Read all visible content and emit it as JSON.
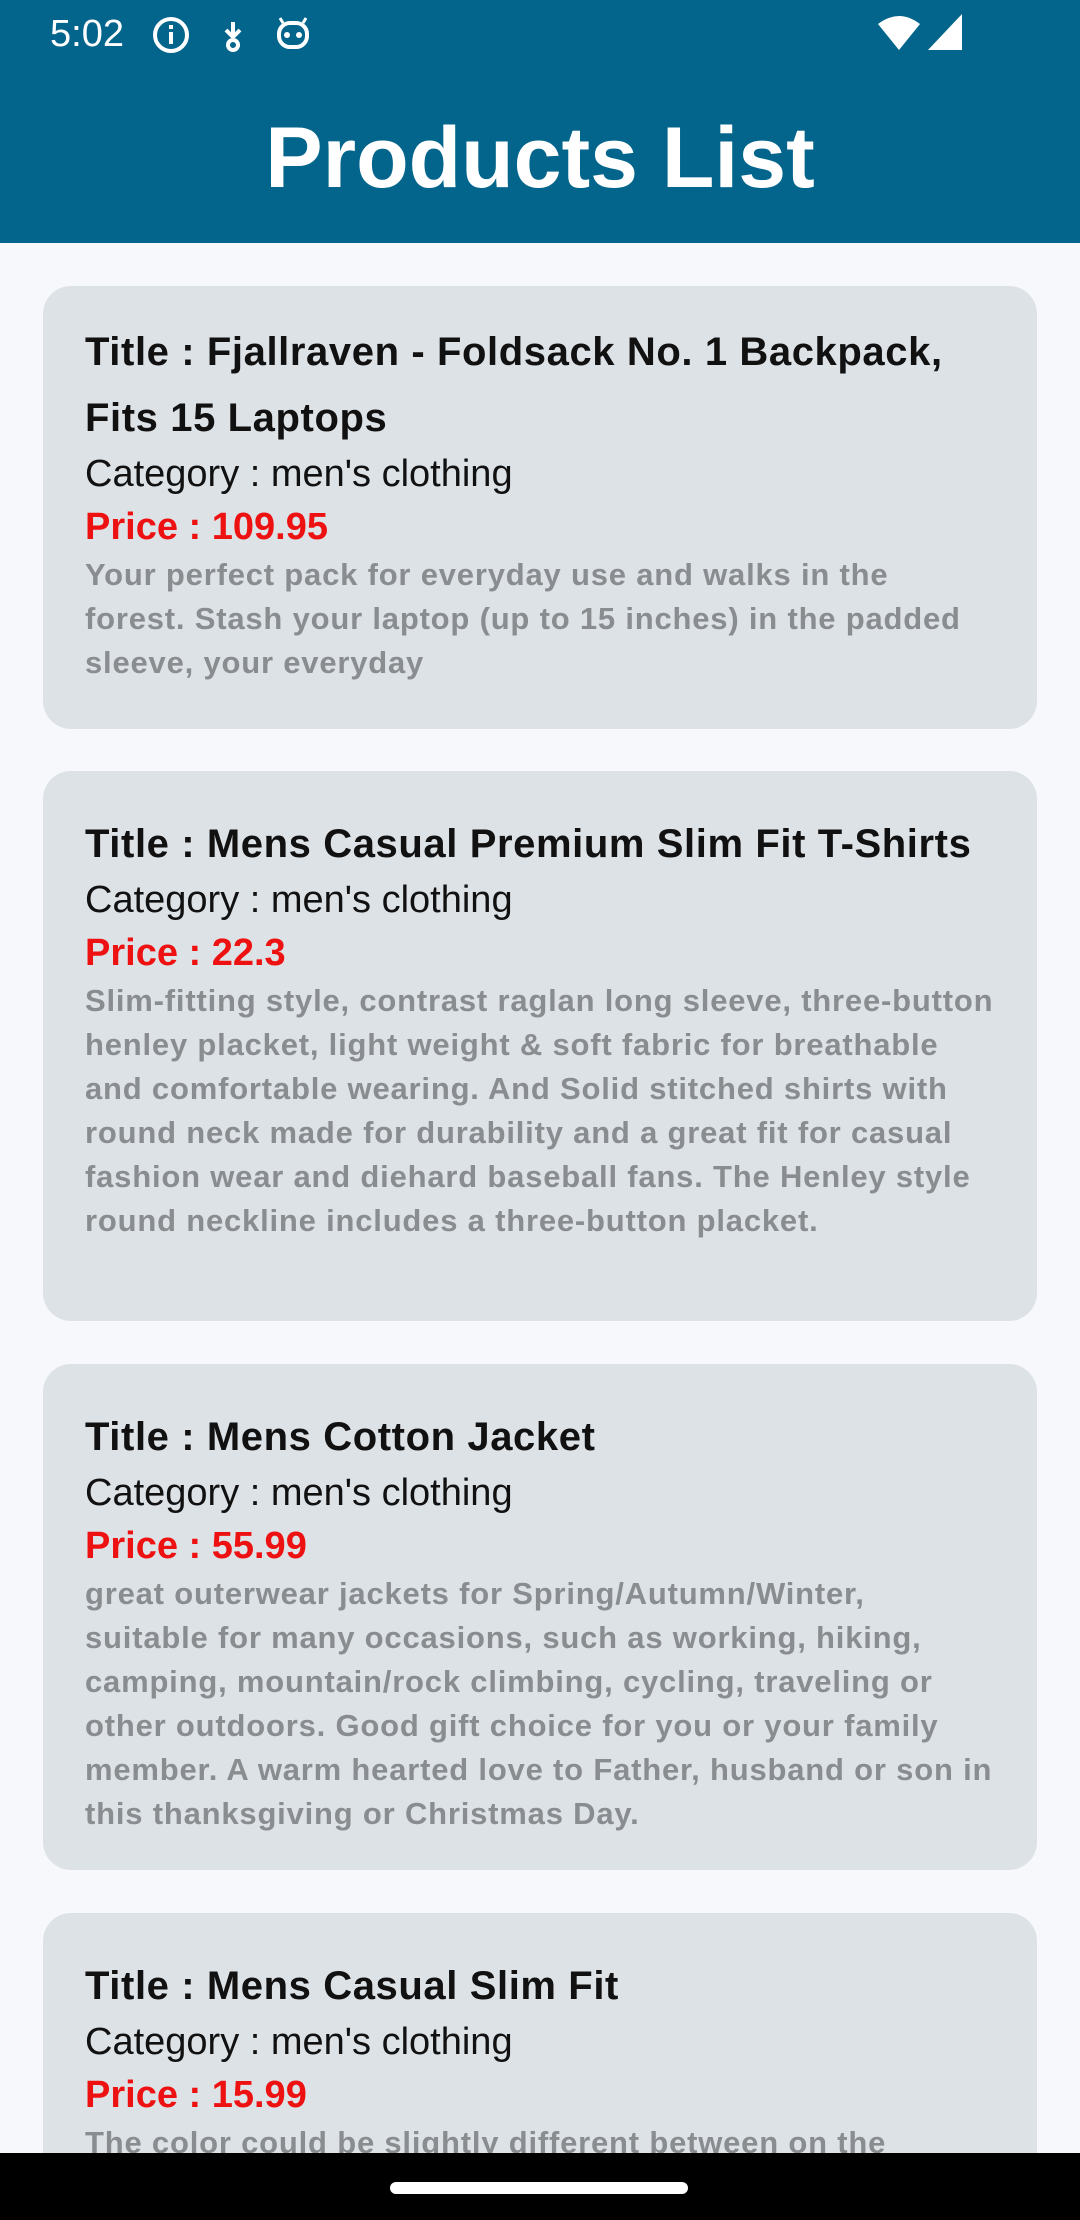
{
  "status_bar": {
    "time": "5:02",
    "icons_left": [
      "info-icon",
      "download-arrow-icon",
      "android-robot-icon"
    ],
    "icons_right": [
      "wifi-icon",
      "cell-signal-icon"
    ]
  },
  "header": {
    "title": "Products List",
    "background_color": "#03658c"
  },
  "products": [
    {
      "title": "Title : Fjallraven - Foldsack No. 1 Backpack, Fits 15 Laptops",
      "category": "Category : men's clothing",
      "price": "Price : 109.95",
      "description": "Your perfect pack for everyday use and walks in the forest. Stash your laptop (up to 15 inches) in the padded sleeve, your everyday"
    },
    {
      "title": "Title : Mens Casual Premium Slim Fit T-Shirts",
      "category": "Category : men's clothing",
      "price": "Price : 22.3",
      "description": "Slim-fitting style, contrast raglan long sleeve, three-button henley placket, light weight & soft fabric for breathable and comfortable wearing. And Solid stitched shirts with round neck made for durability and a great fit for casual fashion wear and diehard baseball fans. The Henley style round neckline includes a three-button placket."
    },
    {
      "title": "Title : Mens Cotton Jacket",
      "category": "Category : men's clothing",
      "price": "Price : 55.99",
      "description": "great outerwear jackets for Spring/Autumn/Winter, suitable for many occasions, such as working, hiking, camping, mountain/rock climbing, cycling, traveling or other outdoors. Good gift choice for you or your family member. A warm hearted love to Father, husband or son in this thanksgiving or Christmas Day."
    },
    {
      "title": "Title : Mens Casual Slim Fit",
      "category": "Category : men's clothing",
      "price": "Price : 15.99",
      "description": "The color could be slightly different between on the"
    }
  ],
  "colors": {
    "card_background": "#dde2e7",
    "price": "#ee1111",
    "description": "#8a8d90"
  }
}
